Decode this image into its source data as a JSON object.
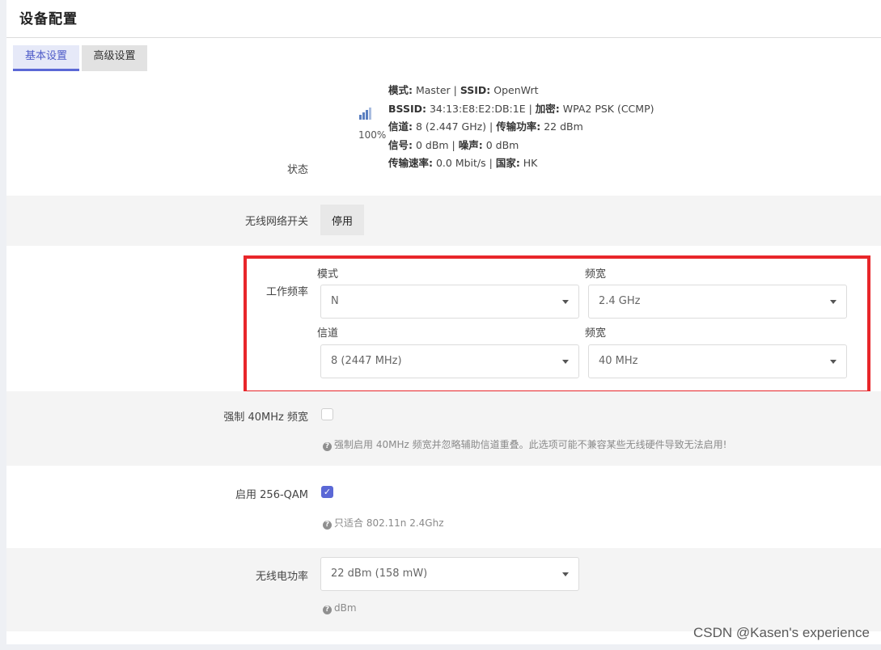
{
  "page": {
    "title": "设备配置"
  },
  "tabs": [
    {
      "label": "基本设置",
      "active": true
    },
    {
      "label": "高级设置",
      "active": false
    }
  ],
  "status": {
    "label": "状态",
    "signal_percent": "100%",
    "line1_mode_label": "模式:",
    "line1_mode_value": " Master | ",
    "line1_ssid_label": "SSID:",
    "line1_ssid_value": " OpenWrt",
    "line2_bssid_label": "BSSID:",
    "line2_bssid_value": " 34:13:E8:E2:DB:1E | ",
    "line2_enc_label": "加密:",
    "line2_enc_value": " WPA2 PSK (CCMP)",
    "line3_channel_label": "信道:",
    "line3_channel_value": " 8 (2.447 GHz) | ",
    "line3_power_label": "传输功率:",
    "line3_power_value": " 22 dBm",
    "line4_signal_label": "信号:",
    "line4_signal_value": " 0 dBm | ",
    "line4_noise_label": "噪声:",
    "line4_noise_value": " 0 dBm",
    "line5_rate_label": "传输速率:",
    "line5_rate_value": " 0.0 Mbit/s | ",
    "line5_country_label": "国家:",
    "line5_country_value": " HK"
  },
  "wireless_switch": {
    "label": "无线网络开关",
    "button_label": "停用"
  },
  "frequency": {
    "label": "工作频率",
    "mode_label": "模式",
    "mode_value": "N",
    "band_label": "频宽",
    "band_value": "2.4 GHz",
    "channel_label": "信道",
    "channel_value": "8 (2447 MHz)",
    "width_label": "频宽",
    "width_value": "40 MHz"
  },
  "force40": {
    "label": "强制 40MHz 频宽",
    "checked": false,
    "help": "强制启用 40MHz 频宽并忽略辅助信道重叠。此选项可能不兼容某些无线硬件导致无法启用!"
  },
  "qam256": {
    "label": "启用 256-QAM",
    "checked": true,
    "help": "只适合 802.11n 2.4Ghz"
  },
  "txpower": {
    "label": "无线电功率",
    "value": "22 dBm (158 mW)",
    "help": "dBm"
  },
  "watermark": "CSDN @Kasen's experience",
  "colors": {
    "accent": "#5b68d6",
    "highlight": "#e8262a",
    "row_grey": "#f4f4f4",
    "signal": "#5a7fc0"
  },
  "icons": {
    "signal": "signal-bars-icon",
    "caret": "chevron-down-icon",
    "help": "question-circle-icon",
    "check": "checkmark-icon"
  }
}
